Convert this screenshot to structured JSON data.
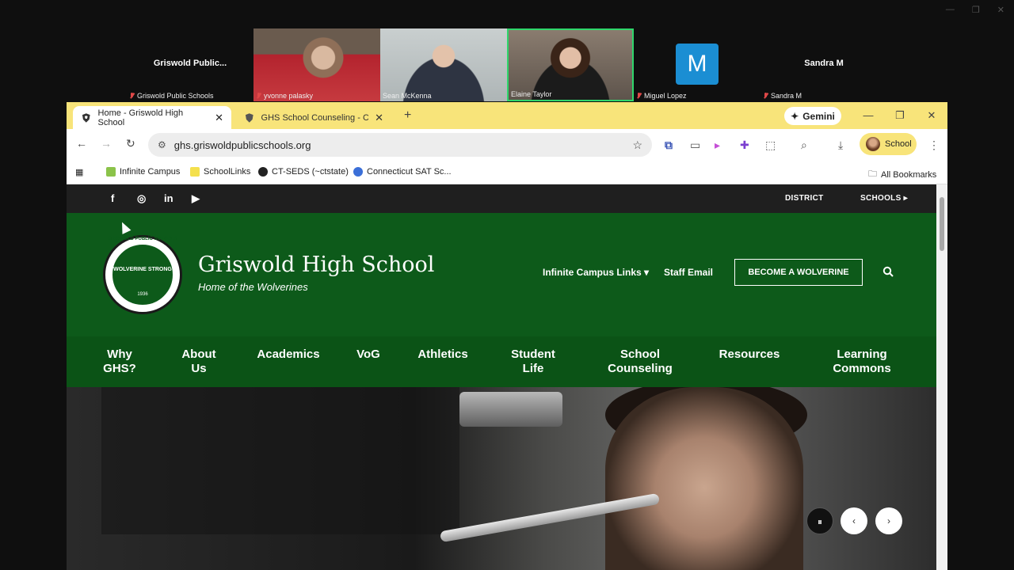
{
  "zoom": {
    "tiles": [
      {
        "kind": "label",
        "big_name": "Griswold  Public...",
        "name": "Griswold Public Schools"
      },
      {
        "kind": "video",
        "name": "yvonne palasky"
      },
      {
        "kind": "video",
        "name": "Sean McKenna"
      },
      {
        "kind": "video",
        "name": "Elaine Taylor"
      },
      {
        "kind": "avatar",
        "initial": "M",
        "name": "Miguel Lopez"
      },
      {
        "kind": "label",
        "big_name": "Sandra M",
        "name": "Sandra M"
      }
    ]
  },
  "browser": {
    "tabs": [
      {
        "title": "Home - Griswold High School",
        "close": "✕"
      },
      {
        "title": "GHS School Counseling - Cour",
        "close": "✕"
      }
    ],
    "new_tab": "+",
    "gemini_label": "Gemini",
    "url": "ghs.griswoldpublicschools.org",
    "profile_label": "School",
    "bookmarks": [
      {
        "label": "Infinite Campus",
        "color": "#8bc34a"
      },
      {
        "label": "SchoolLinks",
        "color": "#f4e04d"
      },
      {
        "label": "CT-SEDS (~ctstate)",
        "color": "#222222"
      },
      {
        "label": "Connecticut SAT Sc...",
        "color": "#3b6fd8"
      }
    ],
    "all_bookmarks": "All Bookmarks"
  },
  "site": {
    "topbar": {
      "district": "DISTRICT",
      "schools": "SCHOOLS ▸"
    },
    "social": [
      "f",
      "◎",
      "in",
      "▶"
    ],
    "seal": {
      "text": "GRISWOLD PUBLIC SCHOOLS",
      "motto": "WOLVERINE STRONG",
      "year": "1936"
    },
    "title": "Griswold High School",
    "subtitle": "Home of the Wolverines",
    "links": {
      "campus": "Infinite Campus Links ▾",
      "email": "Staff Email",
      "become": "BECOME A WOLVERINE"
    },
    "nav": [
      {
        "l1": "Why",
        "l2": "GHS?"
      },
      {
        "l1": "About",
        "l2": "Us"
      },
      {
        "l1": "Academics",
        "l2": ""
      },
      {
        "l1": "VoG",
        "l2": ""
      },
      {
        "l1": "Athletics",
        "l2": ""
      },
      {
        "l1": "Student",
        "l2": "Life"
      },
      {
        "l1": "School",
        "l2": "Counseling"
      },
      {
        "l1": "Resources",
        "l2": ""
      },
      {
        "l1": "Learning",
        "l2": "Commons"
      }
    ],
    "slider": {
      "pause": "⏸",
      "prev": "‹",
      "next": "›"
    }
  },
  "colors": {
    "brand_green": "#0d5a1a",
    "tab_yellow": "#f8e47a",
    "zoom_avatar": "#1b8ed3"
  }
}
